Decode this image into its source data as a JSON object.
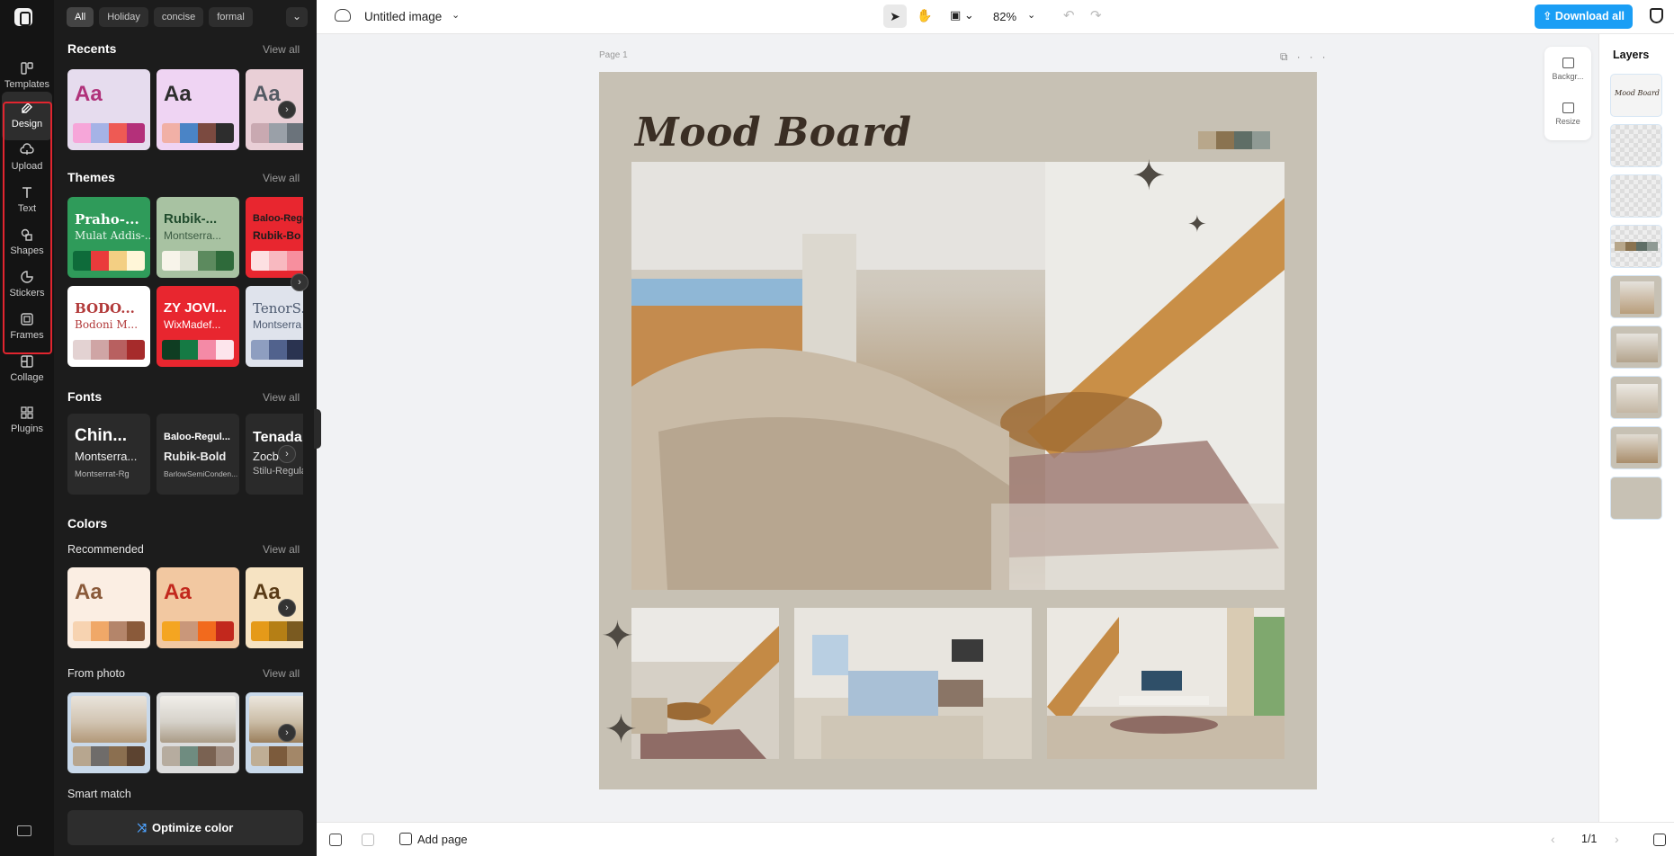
{
  "rail": {
    "items": [
      {
        "label": "Templates",
        "icon": "templates-icon"
      },
      {
        "label": "Design",
        "icon": "design-icon"
      },
      {
        "label": "Upload",
        "icon": "upload-icon"
      },
      {
        "label": "Text",
        "icon": "text-icon"
      },
      {
        "label": "Shapes",
        "icon": "shapes-icon"
      },
      {
        "label": "Stickers",
        "icon": "stickers-icon"
      },
      {
        "label": "Frames",
        "icon": "frames-icon"
      },
      {
        "label": "Collage",
        "icon": "collage-icon"
      },
      {
        "label": "Plugins",
        "icon": "plugins-icon"
      }
    ],
    "active": "Design"
  },
  "filters": [
    "All",
    "Holiday",
    "concise",
    "formal"
  ],
  "panel": {
    "recents": {
      "title": "Recents",
      "view_all": "View all",
      "sample": "Aa"
    },
    "themes": {
      "title": "Themes",
      "view_all": "View all",
      "items": [
        {
          "name": "Praho-...",
          "sub": "Mulat Addis-..."
        },
        {
          "name": "Rubik-...",
          "sub": "Montserra..."
        },
        {
          "name": "Baloo-Rege",
          "sub": "Rubik-Bo"
        },
        {
          "name": "BODO...",
          "sub": "Bodoni M..."
        },
        {
          "name": "ZY JOVI...",
          "sub": "WixMadef..."
        },
        {
          "name": "TenorS...",
          "sub": "Montserra"
        }
      ]
    },
    "fonts": {
      "title": "Fonts",
      "view_all": "View all",
      "items": [
        {
          "big": "Chin...",
          "mid": "Montserra...",
          "small": "Montserrat-Rg"
        },
        {
          "big": "Baloo-Regul...",
          "mid": "Rubik-Bold",
          "small": "BarlowSemiConden..."
        },
        {
          "big": "Tenada",
          "mid": "Zocbe",
          "small": "Stilu-Regula"
        }
      ]
    },
    "colors": {
      "title": "Colors",
      "recommended": "Recommended",
      "recommended_view_all": "View all",
      "sample": "Aa",
      "from_photo": "From photo",
      "from_photo_view_all": "View all",
      "smart_match": "Smart match",
      "optimize": "Optimize color"
    }
  },
  "topbar": {
    "title": "Untitled image",
    "zoom": "82%",
    "download": "Download all"
  },
  "canvas": {
    "page_label": "Page 1",
    "board_title": "Mood Board",
    "palette": [
      "#b8a78b",
      "#8a7350",
      "#5f6e66",
      "#8f9a94"
    ]
  },
  "side_tools": {
    "background": "Backgr...",
    "resize": "Resize"
  },
  "layers": {
    "title": "Layers",
    "first_label": "Mood Board"
  },
  "bottombar": {
    "add_page": "Add page",
    "pages": "1/1"
  }
}
